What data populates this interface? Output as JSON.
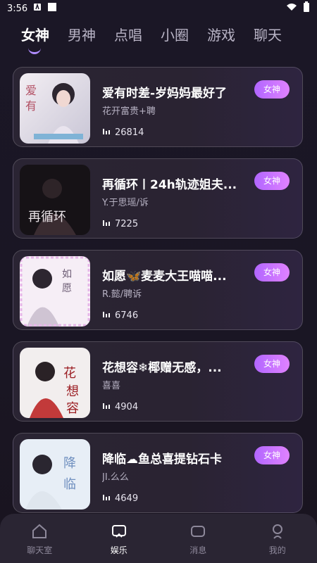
{
  "status": {
    "time": "3:56"
  },
  "tabs": [
    "女神",
    "男神",
    "点唱",
    "小圈",
    "游戏",
    "聊天"
  ],
  "rooms": [
    {
      "title": "爱有时差-岁妈妈最好了",
      "host": "花开富贵+聘",
      "plays": "26814",
      "badge": "女神"
    },
    {
      "title": "再循环〡24h轨迹姐夫...",
      "host": "Y.于思瑶/诉",
      "plays": "7225",
      "badge": "女神"
    },
    {
      "title": "如愿🦋麦麦大王喵喵...",
      "host": "R.懿/聘诉",
      "plays": "6746",
      "badge": "女神"
    },
    {
      "title": "花想容❄椰赠无感，...",
      "host": "喜喜",
      "plays": "4904",
      "badge": "女神"
    },
    {
      "title": "降临☁鱼总喜提钻石卡",
      "host": "JI.么么",
      "plays": "4649",
      "badge": "女神"
    }
  ],
  "nav": [
    {
      "label": "聊天室",
      "icon": "home-icon",
      "active": false
    },
    {
      "label": "娱乐",
      "icon": "entertainment-icon",
      "active": true
    },
    {
      "label": "消息",
      "icon": "message-icon",
      "active": false
    },
    {
      "label": "我的",
      "icon": "profile-icon",
      "active": false
    }
  ]
}
